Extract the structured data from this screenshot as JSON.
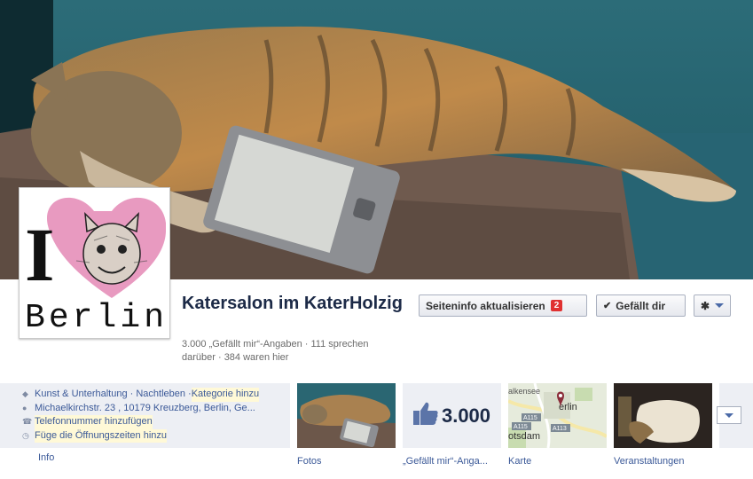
{
  "page": {
    "name": "Katersalon im KaterHolzig",
    "stats": "3.000 „Gefällt mir“-Angaben · 111 sprechen darüber · 384 waren hier"
  },
  "profile_picture": {
    "text_i": "I",
    "text_city": "Berlin"
  },
  "actions": {
    "update_info_label": "Seiteninfo aktualisieren",
    "update_info_badge": "2",
    "liked_label": "Gefällt dir"
  },
  "about": {
    "category_main": "Kunst & Unterhaltung · Nachtleben · ",
    "category_link": "Kategorie hinzu",
    "address": "Michaelkirchstr. 23 , 10179 Kreuzberg, Berlin, Ge...",
    "phone_link": "Telefonnummer hinzufügen",
    "hours_link": "Füge die Öffnungszeiten hinzu",
    "tab_label": "Info"
  },
  "tiles": [
    {
      "label": "Fotos"
    },
    {
      "label": "„Gefällt mir“-Anga...",
      "value": "3.000"
    },
    {
      "label": "Karte",
      "map_labels": [
        "alkensee",
        "erlin",
        "otsdam",
        "A115",
        "A115",
        "A113"
      ]
    },
    {
      "label": "Veranstaltungen"
    }
  ],
  "colors": {
    "link": "#3b5998",
    "name": "#1c2a47",
    "badge": "#e03131",
    "panel": "#edeff4"
  }
}
